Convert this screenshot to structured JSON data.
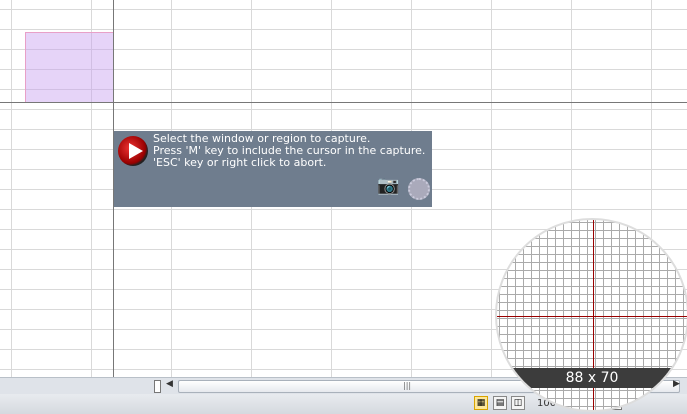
{
  "capture_tip": {
    "lines": [
      "Select the window or region to capture.",
      "Press 'M' key to include the cursor in the capture.",
      "'ESC' key or right click to abort."
    ],
    "icons": [
      "app-logo-icon",
      "camera-icon",
      "film-reel-icon"
    ]
  },
  "magnifier": {
    "size_label": "88 x 70"
  },
  "status_bar": {
    "zoom_label": "100 %"
  },
  "colors": {
    "selection": "#c8a0f0",
    "tooltip_bg": "#6f7d8e",
    "crosshair": "#990000"
  }
}
